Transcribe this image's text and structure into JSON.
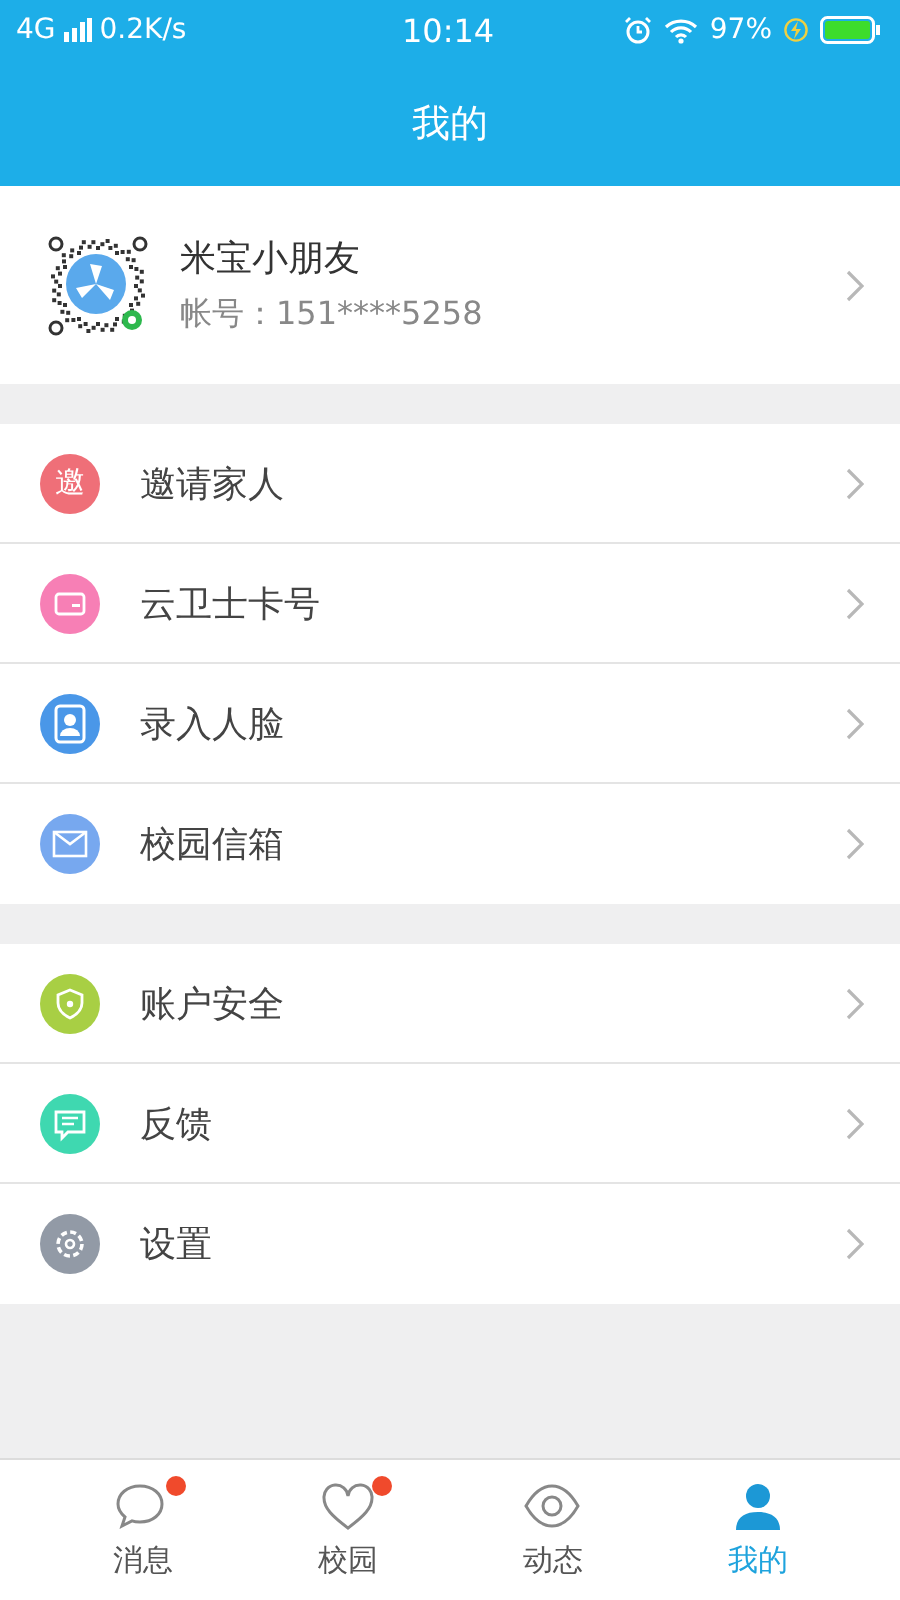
{
  "status_bar": {
    "network": "4G",
    "speed": "0.2K/s",
    "time": "10:14",
    "battery": "97%"
  },
  "header": {
    "title": "我的"
  },
  "profile": {
    "name": "米宝小朋友",
    "account_label": "帐号：",
    "account": "151****5258"
  },
  "menu_groups": [
    {
      "items": [
        {
          "label": "邀请家人",
          "kind": "char",
          "glyph": "邀",
          "color": "#ef6f78"
        },
        {
          "label": "云卫士卡号",
          "kind": "card",
          "color": "#f77fb5"
        },
        {
          "label": "录入人脸",
          "kind": "face",
          "color": "#4a97e8"
        },
        {
          "label": "校园信箱",
          "kind": "mail",
          "color": "#77a8ef"
        }
      ]
    },
    {
      "items": [
        {
          "label": "账户安全",
          "kind": "shield",
          "color": "#a8cf44"
        },
        {
          "label": "反馈",
          "kind": "chat",
          "color": "#3fd8b0"
        },
        {
          "label": "设置",
          "kind": "gear",
          "color": "#929aa6"
        }
      ]
    }
  ],
  "bottom_nav": [
    {
      "label": "消息",
      "kind": "bubble",
      "badge": true,
      "selected": false
    },
    {
      "label": "校园",
      "kind": "heart",
      "badge": true,
      "selected": false
    },
    {
      "label": "动态",
      "kind": "eye",
      "badge": false,
      "selected": false
    },
    {
      "label": "我的",
      "kind": "person",
      "badge": false,
      "selected": true
    }
  ]
}
